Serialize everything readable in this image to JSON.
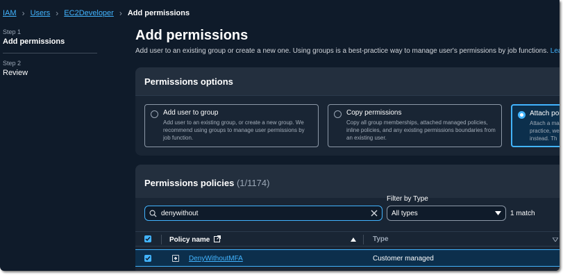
{
  "breadcrumb": {
    "items": [
      "IAM",
      "Users",
      "EC2Developer"
    ],
    "current": "Add permissions"
  },
  "steps": [
    {
      "label": "Step 1",
      "title": "Add permissions"
    },
    {
      "label": "Step 2",
      "title": "Review"
    }
  ],
  "page": {
    "title": "Add permissions",
    "description": "Add user to an existing group or create a new one. Using groups is a best-practice way to manage user's permissions by job functions.",
    "learn_more": "Learn mo"
  },
  "permissions_options": {
    "title": "Permissions options",
    "options": [
      {
        "title": "Add user to group",
        "desc": "Add user to an existing group, or create a new group. We recommend using groups to manage user permissions by job function.",
        "selected": false
      },
      {
        "title": "Copy permissions",
        "desc": "Copy all group memberships, attached managed policies, inline policies, and any existing permissions boundaries from an existing user.",
        "selected": false
      },
      {
        "title": "Attach pol",
        "desc": "Attach a ma practice, we instead. Th",
        "selected": true
      }
    ]
  },
  "permissions_policies": {
    "title": "Permissions policies",
    "count": "(1/1174)",
    "search_value": "denywithout",
    "filter_label": "Filter by Type",
    "filter_value": "All types",
    "match_text": "1 match",
    "columns": {
      "policy_name": "Policy name",
      "type": "Type"
    },
    "rows": [
      {
        "name": "DenyWithoutMFA",
        "type": "Customer managed",
        "checked": true
      }
    ]
  },
  "colors": {
    "background": "#0f1b2a",
    "panel": "#192534",
    "accent": "#42b4ff",
    "selected_bg": "#0c2f4c"
  }
}
